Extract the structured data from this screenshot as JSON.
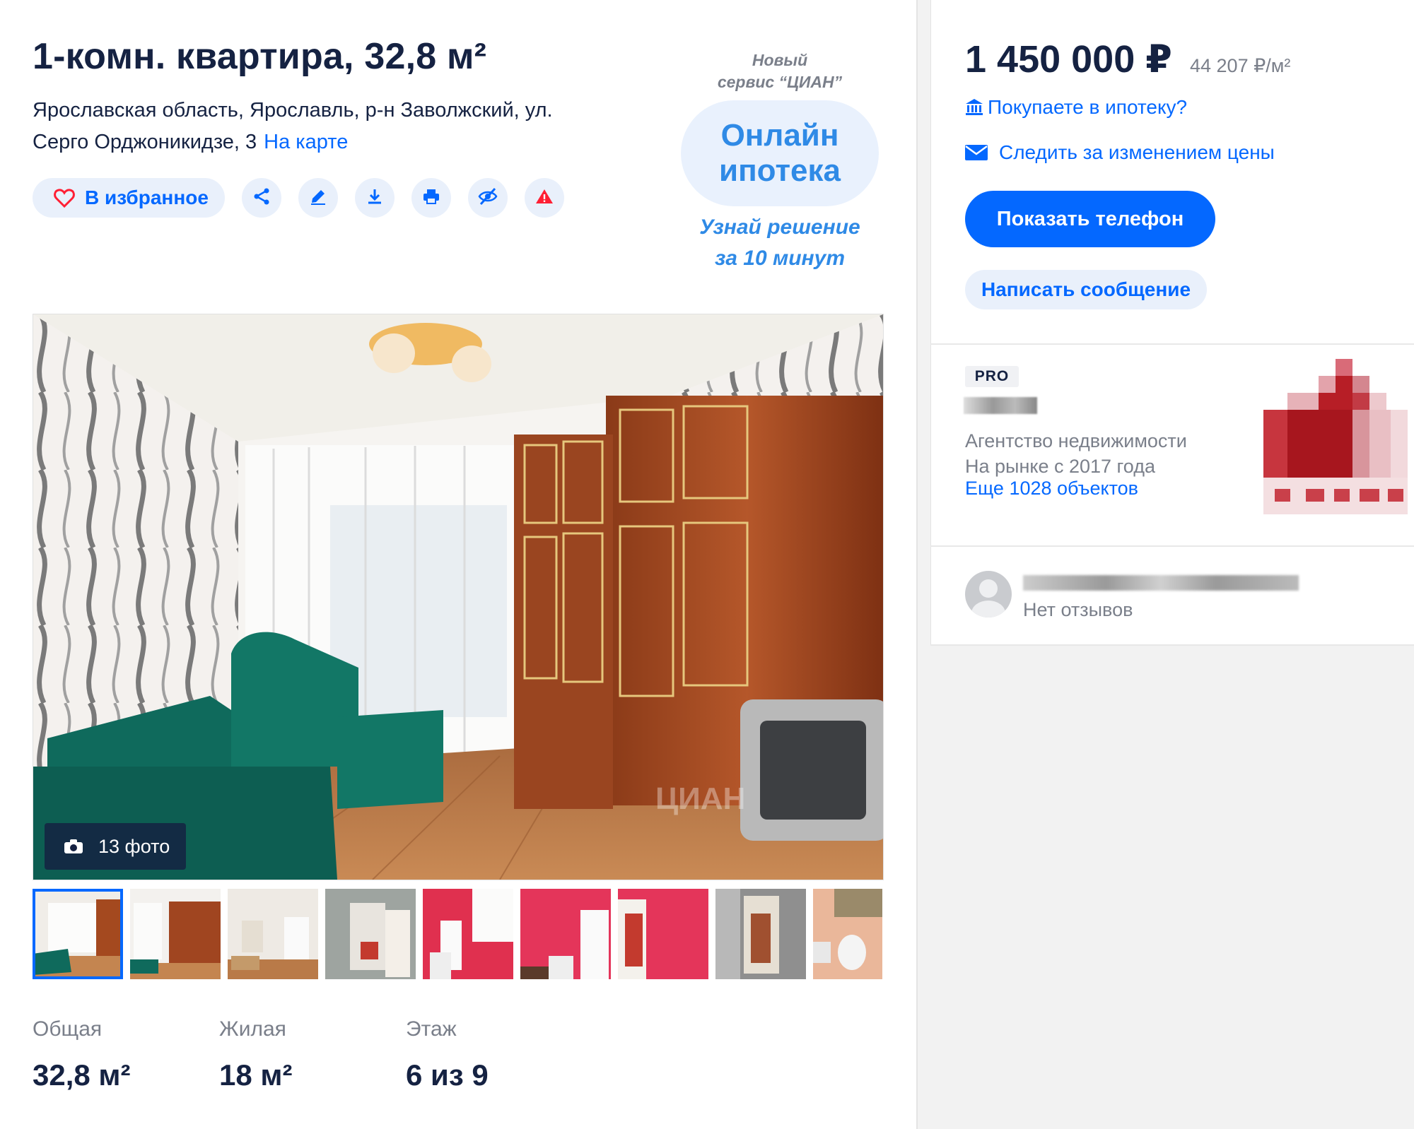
{
  "listing": {
    "title": "1-комн. квартира, 32,8 м²",
    "address": "Ярославская область, Ярославль, р-н Заволжский, ул. Серго Орджоникидзе, 3",
    "map_link": "На карте",
    "favorite_label": "В избранное",
    "action_icons": [
      "share-icon",
      "edit-icon",
      "download-icon",
      "print-icon",
      "hide-icon",
      "report-icon"
    ]
  },
  "promo": {
    "line1": "Новый",
    "line2": "сервис “ЦИАН”",
    "headline1": "Онлайн",
    "headline2": "ипотека",
    "tag1": "Узнай решение",
    "tag2": "за 10 минут"
  },
  "gallery": {
    "photo_count": "13 фото",
    "watermark": "ЦИАН",
    "thumbnails": 9,
    "selected_index": 0
  },
  "stats": [
    {
      "label": "Общая",
      "value": "32,8 м²"
    },
    {
      "label": "Жилая",
      "value": "18 м²"
    },
    {
      "label": "Этаж",
      "value": "6 из 9"
    }
  ],
  "price": {
    "total": "1 450 000 ₽",
    "per_m2": "44 207 ₽/м²",
    "mortgage_link": "Покупаете в ипотеку?",
    "track_link": "Следить за изменением цены",
    "show_phone": "Показать телефон",
    "write_message": "Написать сообщение"
  },
  "agent": {
    "badge": "PRO",
    "type": "Агентство недвижимости",
    "since": "На рынке с 2017 года",
    "objects_link": "Еще 1028 объектов"
  },
  "reviews": {
    "text": "Нет отзывов"
  },
  "colors": {
    "accent": "#0468ff",
    "text": "#152242",
    "muted": "#7a7f8a",
    "button_bg": "#e9f0fb",
    "danger": "#ff1f34"
  }
}
